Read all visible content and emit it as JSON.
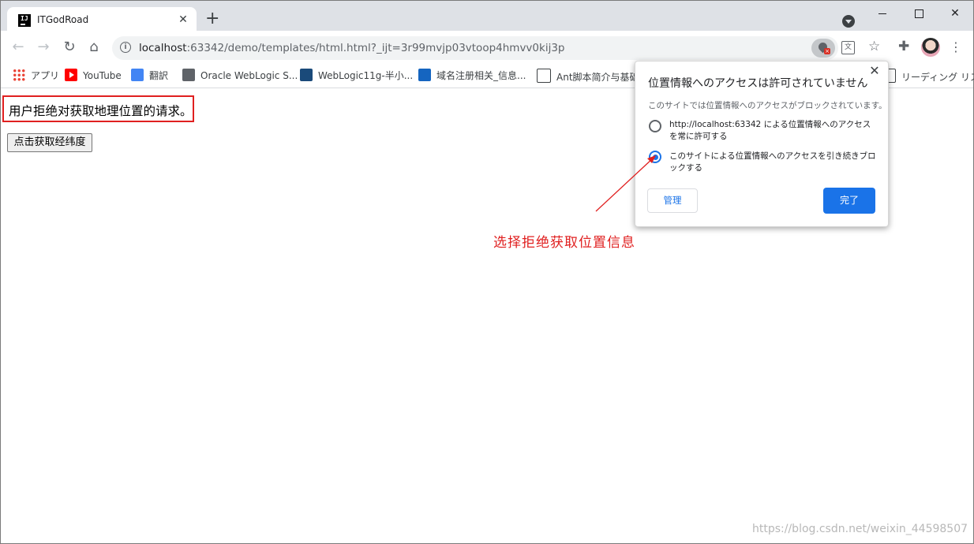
{
  "tab": {
    "favicon_text": "IJ",
    "title": "ITGodRoad",
    "close": "✕",
    "new_tab": "+"
  },
  "window": {
    "close": "✕"
  },
  "nav": {
    "back": "←",
    "forward": "→",
    "reload": "↻",
    "home": "⌂"
  },
  "address_bar": {
    "host": "localhost",
    "rest": ":63342/demo/templates/html.html?_ijt=3r99mvjp03vtoop4hmvv0kij3p",
    "info_icon": "i"
  },
  "toolbar": {
    "translate": "文",
    "star": "☆",
    "extensions": "✚",
    "menu": "⋮"
  },
  "bookmarks": {
    "items": [
      {
        "label": "アプリ",
        "icon": "apps-grid-icon"
      },
      {
        "label": "YouTube",
        "icon": "youtube-icon"
      },
      {
        "label": "翻訳",
        "icon": "google-translate-icon"
      },
      {
        "label": "Oracle WebLogic S...",
        "icon": "globe-icon"
      },
      {
        "label": "WebLogic11g-半小...",
        "icon": "csdn-icon"
      },
      {
        "label": "域名注册相关_信息...",
        "icon": "vs-icon"
      },
      {
        "label": "Ant脚本简介与基础",
        "icon": "ant-icon"
      }
    ],
    "reading_list": "リーディング リスト"
  },
  "page": {
    "message": "用户拒绝对获取地理位置的请求。",
    "button_label": "点击获取经纬度"
  },
  "popup": {
    "title": "位置情報へのアクセスは許可されていません",
    "close": "✕",
    "description": "このサイトでは位置情報へのアクセスがブロックされています。",
    "options": [
      {
        "label": "http://localhost:63342 による位置情報へのアクセスを常に許可する",
        "checked": false
      },
      {
        "label": "このサイトによる位置情報へのアクセスを引き続きブロックする",
        "checked": true
      }
    ],
    "manage_label": "管理",
    "done_label": "完了"
  },
  "annotation": {
    "text": "选择拒绝获取位置信息",
    "color": "#e02020"
  },
  "watermark": "https://blog.csdn.net/weixin_44598507"
}
